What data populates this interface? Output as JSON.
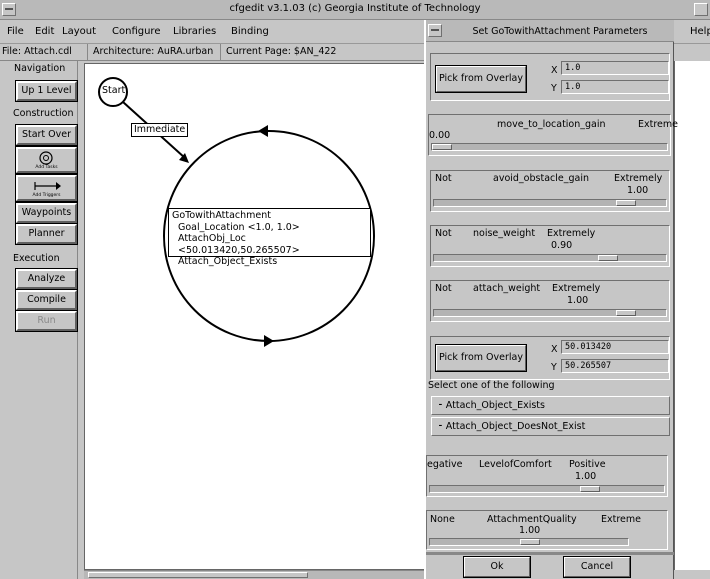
{
  "app": {
    "title": "cfgedit  v3.1.03  (c) Georgia Institute of Technology"
  },
  "menu": {
    "items": [
      "File",
      "Edit",
      "Layout",
      "Configure",
      "Libraries",
      "Binding"
    ],
    "help": "Help"
  },
  "info": {
    "file": "File: Attach.cdl",
    "architecture": "Architecture: AuRA.urban",
    "page": "Current Page:  $AN_422"
  },
  "sidebar": {
    "navigation_label": "Navigation",
    "up_level": "Up 1 Level",
    "construction_label": "Construction",
    "start_over": "Start Over",
    "add_tasks": "Add Tasks",
    "add_triggers": "Add Triggers",
    "waypoints": "Waypoints",
    "planner": "Planner",
    "execution_label": "Execution",
    "analyze": "Analyze",
    "compile": "Compile",
    "run": "Run"
  },
  "canvas": {
    "start_label": "Start",
    "trigger_label": "Immediate",
    "state_lines": [
      "GoTowithAttachment",
      "Goal_Location <1.0, 1.0>",
      "AttachObj_Loc <50.013420,50.265507>",
      "Attach_Object_Exists"
    ]
  },
  "dialog": {
    "title": "Set GoTowithAttachment Parameters",
    "pick1": {
      "button": "Pick from Overlay",
      "x_label": "X",
      "y_label": "Y",
      "x_value": "1.0",
      "y_value": "1.0"
    },
    "sliders": [
      {
        "title": "move_to_location_gain",
        "left": "",
        "right": "Extreme",
        "value": "0.00",
        "level": 0.0
      },
      {
        "title": "avoid_obstacle_gain",
        "left": "Not",
        "right": "Extremely",
        "value": "1.00",
        "level": 0.1
      },
      {
        "title": "noise_weight",
        "left": "Not",
        "right": "Extremely",
        "value": "0.90",
        "level": 0.09
      },
      {
        "title": "attach_weight",
        "left": "Not",
        "right": "Extremely",
        "value": "1.00",
        "level": 0.1
      }
    ],
    "pick2": {
      "button": "Pick from Overlay",
      "x_label": "X",
      "y_label": "Y",
      "x_value": "50.013420",
      "y_value": "50.265507"
    },
    "select_prompt": "Select one of the following",
    "options": [
      "Attach_Object_Exists",
      "Attach_Object_DoesNot_Exist"
    ],
    "comfort": {
      "left": "egative",
      "title": "LevelofComfort",
      "right": "Positive",
      "value": "1.00"
    },
    "quality": {
      "left": "None",
      "title": "AttachmentQuality",
      "right": "Extreme",
      "value": "1.00"
    },
    "ok": "Ok",
    "cancel": "Cancel"
  }
}
